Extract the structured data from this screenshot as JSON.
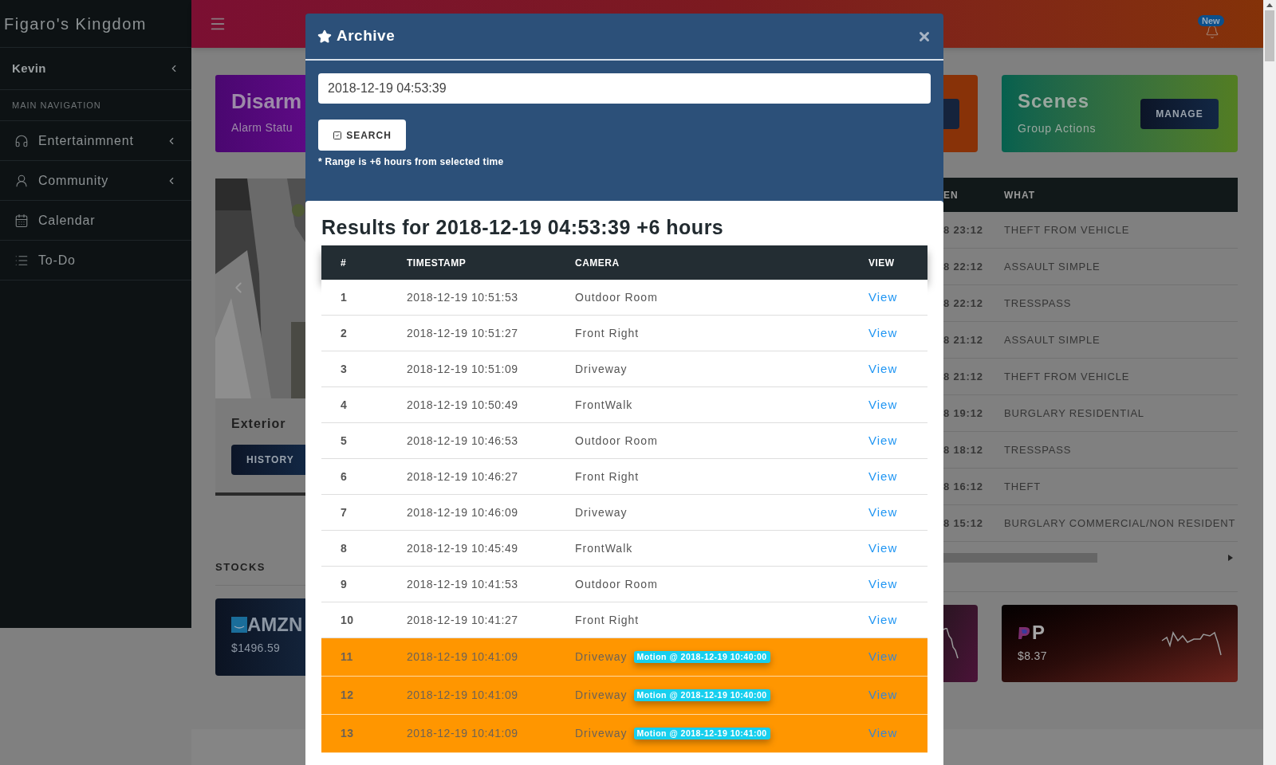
{
  "sidebar": {
    "brand": "Figaro's Kingdom",
    "user": {
      "name": "Kevin",
      "expandable": true
    },
    "section_label": "MAIN NAVIGATION",
    "items": [
      {
        "label": "Entertainmnent",
        "expandable": true
      },
      {
        "label": "Community",
        "expandable": true
      },
      {
        "label": "Calendar",
        "expandable": false
      },
      {
        "label": "To-Do",
        "expandable": false
      }
    ]
  },
  "topbar": {
    "badge": "New"
  },
  "cards": {
    "alarm": {
      "title": "Disarm",
      "subtitle": "Alarm Statu"
    },
    "scenes": {
      "title": "Scenes",
      "subtitle": "Group Actions",
      "button": "MANAGE"
    }
  },
  "camera": {
    "title": "Exterior",
    "button": "HISTORY"
  },
  "incidents": {
    "columns": [
      "EN",
      "WHAT"
    ],
    "rows": [
      {
        "when": "8 23:12",
        "what": "THEFT FROM VEHICLE"
      },
      {
        "when": "8 22:12",
        "what": "ASSAULT SIMPLE"
      },
      {
        "when": "8 22:12",
        "what": "TRESSPASS"
      },
      {
        "when": "8 21:12",
        "what": "ASSAULT SIMPLE"
      },
      {
        "when": "8 21:12",
        "what": "THEFT FROM VEHICLE"
      },
      {
        "when": "8 19:12",
        "what": "BURGLARY RESIDENTIAL"
      },
      {
        "when": "8 18:12",
        "what": "TRESSPASS"
      },
      {
        "when": "8 16:12",
        "what": "THEFT"
      },
      {
        "when": "8 15:12",
        "what": "BURGLARY COMMERCIAL/NON RESIDENT"
      }
    ]
  },
  "stocks": {
    "label": "STOCKS",
    "items": [
      {
        "symbol": "AMZN",
        "price": "$1496.59"
      },
      {
        "symbol": "P",
        "price": "$8.37"
      }
    ]
  },
  "modal": {
    "title": "Archive",
    "search_value": "2018-12-19 04:53:39",
    "search_button": "SEARCH",
    "note": "* Range is +6 hours from selected time",
    "results_title": "Results for 2018-12-19 04:53:39 +6 hours",
    "columns": [
      "#",
      "TIMESTAMP",
      "CAMERA",
      "VIEW"
    ],
    "rows": [
      {
        "index": "1",
        "timestamp": "2018-12-19 10:51:53",
        "camera": "Outdoor Room",
        "link": "View",
        "highlighted": false
      },
      {
        "index": "2",
        "timestamp": "2018-12-19 10:51:27",
        "camera": "Front Right",
        "link": "View",
        "highlighted": false
      },
      {
        "index": "3",
        "timestamp": "2018-12-19 10:51:09",
        "camera": "Driveway",
        "link": "View",
        "highlighted": false
      },
      {
        "index": "4",
        "timestamp": "2018-12-19 10:50:49",
        "camera": "FrontWalk",
        "link": "View",
        "highlighted": false
      },
      {
        "index": "5",
        "timestamp": "2018-12-19 10:46:53",
        "camera": "Outdoor Room",
        "link": "View",
        "highlighted": false
      },
      {
        "index": "6",
        "timestamp": "2018-12-19 10:46:27",
        "camera": "Front Right",
        "link": "View",
        "highlighted": false
      },
      {
        "index": "7",
        "timestamp": "2018-12-19 10:46:09",
        "camera": "Driveway",
        "link": "View",
        "highlighted": false
      },
      {
        "index": "8",
        "timestamp": "2018-12-19 10:45:49",
        "camera": "FrontWalk",
        "link": "View",
        "highlighted": false
      },
      {
        "index": "9",
        "timestamp": "2018-12-19 10:41:53",
        "camera": "Outdoor Room",
        "link": "View",
        "highlighted": false
      },
      {
        "index": "10",
        "timestamp": "2018-12-19 10:41:27",
        "camera": "Front Right",
        "link": "View",
        "highlighted": false
      },
      {
        "index": "11",
        "timestamp": "2018-12-19 10:41:09",
        "camera": "Driveway",
        "tag": "Motion @ 2018-12-19 10:40:00",
        "link": "View",
        "highlighted": true
      },
      {
        "index": "12",
        "timestamp": "2018-12-19 10:41:09",
        "camera": "Driveway",
        "tag": "Motion @ 2018-12-19 10:40:00",
        "link": "View",
        "highlighted": true
      },
      {
        "index": "13",
        "timestamp": "2018-12-19 10:41:09",
        "camera": "Driveway",
        "tag": "Motion @ 2018-12-19 10:41:00",
        "link": "View",
        "highlighted": true
      }
    ]
  }
}
